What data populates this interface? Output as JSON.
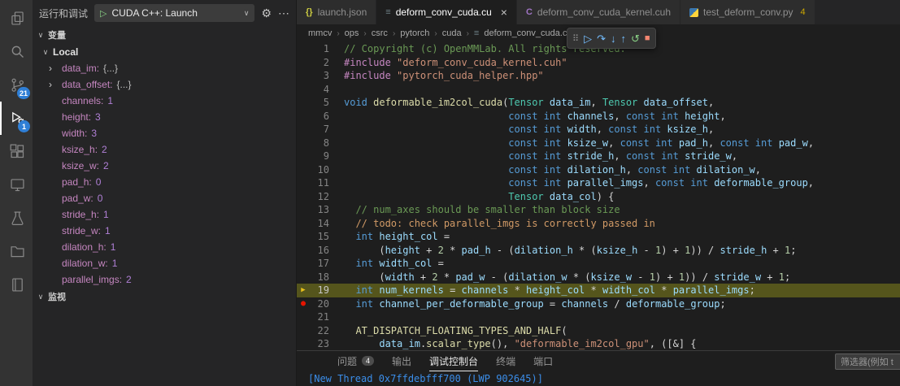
{
  "colors": {
    "badge_blue": "#2f7fd6",
    "current_line_bg": "#55551c",
    "breakpoint_red": "#e51400",
    "execution_arrow_yellow": "#e9c11c",
    "console_blue": "#3b8eea",
    "start_green": "#89d185",
    "debug_icon_blue": "#75beff",
    "stop_red": "#f48771"
  },
  "activity_bar": {
    "items": [
      {
        "name": "explorer"
      },
      {
        "name": "search"
      },
      {
        "name": "source-control",
        "badge": "21"
      },
      {
        "name": "run-debug",
        "badge": "1",
        "active": true
      },
      {
        "name": "extensions"
      },
      {
        "name": "remote"
      },
      {
        "name": "test"
      },
      {
        "name": "folder"
      },
      {
        "name": "notebook"
      }
    ]
  },
  "sidebar": {
    "title": "运行和调试",
    "icons": {
      "chevron_down": "∨",
      "chevron_right": "›"
    },
    "launch": {
      "config_name": "CUDA C++: Launch",
      "play_icon": "▷",
      "dropdown_icon": "∨",
      "gear_icon": "⚙",
      "more_icon": "⋯"
    },
    "variables_section": "变量",
    "scope_label": "Local",
    "watch_section": "监视",
    "variables": [
      {
        "name": "data_im",
        "value": "{...}",
        "expandable": true
      },
      {
        "name": "data_offset",
        "value": "{...}",
        "expandable": true
      },
      {
        "name": "channels",
        "value": "1"
      },
      {
        "name": "height",
        "value": "3"
      },
      {
        "name": "width",
        "value": "3"
      },
      {
        "name": "ksize_h",
        "value": "2"
      },
      {
        "name": "ksize_w",
        "value": "2"
      },
      {
        "name": "pad_h",
        "value": "0"
      },
      {
        "name": "pad_w",
        "value": "0"
      },
      {
        "name": "stride_h",
        "value": "1"
      },
      {
        "name": "stride_w",
        "value": "1"
      },
      {
        "name": "dilation_h",
        "value": "1"
      },
      {
        "name": "dilation_w",
        "value": "1"
      },
      {
        "name": "parallel_imgs",
        "value": "2"
      }
    ]
  },
  "editor_tabs": [
    {
      "label": "launch.json",
      "icon": "json-icon",
      "glyph": "{}",
      "glyph_color": "#cbcb41"
    },
    {
      "label": "deform_conv_cuda.cu",
      "icon": "cuda-source-icon",
      "glyph": "≡",
      "glyph_color": "#6d8086",
      "active": true,
      "close_icon": "×"
    },
    {
      "label": "deform_conv_cuda_kernel.cuh",
      "icon": "c-header-icon",
      "glyph": "C",
      "glyph_color": "#a074c4"
    },
    {
      "label": "test_deform_conv.py",
      "icon": "python-icon",
      "badge": "4"
    }
  ],
  "breadcrumb": {
    "path": [
      "mmcv",
      "ops",
      "csrc",
      "pytorch",
      "cuda"
    ],
    "file": "deform_conv_cuda.cu",
    "file_icon": "≡",
    "separator": "›"
  },
  "debug_toolbar": {
    "grip_icon": "⠿",
    "buttons": [
      {
        "name": "continue",
        "glyph": "▷",
        "color": "#75beff"
      },
      {
        "name": "step-over",
        "glyph": "↷",
        "color": "#75beff"
      },
      {
        "name": "step-into",
        "glyph": "↓",
        "color": "#75beff"
      },
      {
        "name": "step-out",
        "glyph": "↑",
        "color": "#75beff"
      },
      {
        "name": "restart",
        "glyph": "↺",
        "color": "#89d185"
      },
      {
        "name": "stop",
        "glyph": "■",
        "color": "#f48771"
      }
    ]
  },
  "editor": {
    "lines": [
      {
        "n": 1,
        "t": [
          [
            "cm",
            "// Copyright (c) OpenMMLab. All rights reserved."
          ]
        ]
      },
      {
        "n": 2,
        "t": [
          [
            "pp",
            "#include "
          ],
          [
            "st",
            "\"deform_conv_cuda_kernel.cuh\""
          ]
        ]
      },
      {
        "n": 3,
        "t": [
          [
            "pp",
            "#include "
          ],
          [
            "st",
            "\"pytorch_cuda_helper.hpp\""
          ]
        ]
      },
      {
        "n": 4,
        "t": []
      },
      {
        "n": 5,
        "t": [
          [
            "kw",
            "void "
          ],
          [
            "fn",
            "deformable_im2col_cuda"
          ],
          [
            "pl",
            "("
          ],
          [
            "ty",
            "Tensor"
          ],
          [
            "pl",
            " "
          ],
          [
            "vr",
            "data_im"
          ],
          [
            "pl",
            ", "
          ],
          [
            "ty",
            "Tensor"
          ],
          [
            "pl",
            " "
          ],
          [
            "vr",
            "data_offset"
          ],
          [
            "pl",
            ","
          ]
        ]
      },
      {
        "n": 6,
        "t": [
          [
            "pl",
            "                            "
          ],
          [
            "kw",
            "const int"
          ],
          [
            "pl",
            " "
          ],
          [
            "vr",
            "channels"
          ],
          [
            "pl",
            ", "
          ],
          [
            "kw",
            "const int"
          ],
          [
            "pl",
            " "
          ],
          [
            "vr",
            "height"
          ],
          [
            "pl",
            ","
          ]
        ]
      },
      {
        "n": 7,
        "t": [
          [
            "pl",
            "                            "
          ],
          [
            "kw",
            "const int"
          ],
          [
            "pl",
            " "
          ],
          [
            "vr",
            "width"
          ],
          [
            "pl",
            ", "
          ],
          [
            "kw",
            "const int"
          ],
          [
            "pl",
            " "
          ],
          [
            "vr",
            "ksize_h"
          ],
          [
            "pl",
            ","
          ]
        ]
      },
      {
        "n": 8,
        "t": [
          [
            "pl",
            "                            "
          ],
          [
            "kw",
            "const int"
          ],
          [
            "pl",
            " "
          ],
          [
            "vr",
            "ksize_w"
          ],
          [
            "pl",
            ", "
          ],
          [
            "kw",
            "const int"
          ],
          [
            "pl",
            " "
          ],
          [
            "vr",
            "pad_h"
          ],
          [
            "pl",
            ", "
          ],
          [
            "kw",
            "const int"
          ],
          [
            "pl",
            " "
          ],
          [
            "vr",
            "pad_w"
          ],
          [
            "pl",
            ","
          ]
        ]
      },
      {
        "n": 9,
        "t": [
          [
            "pl",
            "                            "
          ],
          [
            "kw",
            "const int"
          ],
          [
            "pl",
            " "
          ],
          [
            "vr",
            "stride_h"
          ],
          [
            "pl",
            ", "
          ],
          [
            "kw",
            "const int"
          ],
          [
            "pl",
            " "
          ],
          [
            "vr",
            "stride_w"
          ],
          [
            "pl",
            ","
          ]
        ]
      },
      {
        "n": 10,
        "t": [
          [
            "pl",
            "                            "
          ],
          [
            "kw",
            "const int"
          ],
          [
            "pl",
            " "
          ],
          [
            "vr",
            "dilation_h"
          ],
          [
            "pl",
            ", "
          ],
          [
            "kw",
            "const int"
          ],
          [
            "pl",
            " "
          ],
          [
            "vr",
            "dilation_w"
          ],
          [
            "pl",
            ","
          ]
        ]
      },
      {
        "n": 11,
        "t": [
          [
            "pl",
            "                            "
          ],
          [
            "kw",
            "const int"
          ],
          [
            "pl",
            " "
          ],
          [
            "vr",
            "parallel_imgs"
          ],
          [
            "pl",
            ", "
          ],
          [
            "kw",
            "const int"
          ],
          [
            "pl",
            " "
          ],
          [
            "vr",
            "deformable_group"
          ],
          [
            "pl",
            ","
          ]
        ]
      },
      {
        "n": 12,
        "t": [
          [
            "pl",
            "                            "
          ],
          [
            "ty",
            "Tensor"
          ],
          [
            "pl",
            " "
          ],
          [
            "vr",
            "data_col"
          ],
          [
            "pl",
            ") {"
          ]
        ]
      },
      {
        "n": 13,
        "t": [
          [
            "pl",
            "  "
          ],
          [
            "cm",
            "// num_axes should be smaller than block size"
          ]
        ]
      },
      {
        "n": 14,
        "t": [
          [
            "pl",
            "  "
          ],
          [
            "td",
            "// todo: check parallel_imgs is correctly passed in"
          ]
        ]
      },
      {
        "n": 15,
        "t": [
          [
            "pl",
            "  "
          ],
          [
            "kw",
            "int"
          ],
          [
            "pl",
            " "
          ],
          [
            "vr",
            "height_col"
          ],
          [
            "pl",
            " ="
          ]
        ]
      },
      {
        "n": 16,
        "t": [
          [
            "pl",
            "      ("
          ],
          [
            "vr",
            "height"
          ],
          [
            "pl",
            " + "
          ],
          [
            "nu",
            "2"
          ],
          [
            "pl",
            " * "
          ],
          [
            "vr",
            "pad_h"
          ],
          [
            "pl",
            " - ("
          ],
          [
            "vr",
            "dilation_h"
          ],
          [
            "pl",
            " * ("
          ],
          [
            "vr",
            "ksize_h"
          ],
          [
            "pl",
            " - "
          ],
          [
            "nu",
            "1"
          ],
          [
            "pl",
            ") + "
          ],
          [
            "nu",
            "1"
          ],
          [
            "pl",
            ")) / "
          ],
          [
            "vr",
            "stride_h"
          ],
          [
            "pl",
            " + "
          ],
          [
            "nu",
            "1"
          ],
          [
            "pl",
            ";"
          ]
        ]
      },
      {
        "n": 17,
        "t": [
          [
            "pl",
            "  "
          ],
          [
            "kw",
            "int"
          ],
          [
            "pl",
            " "
          ],
          [
            "vr",
            "width_col"
          ],
          [
            "pl",
            " ="
          ]
        ]
      },
      {
        "n": 18,
        "t": [
          [
            "pl",
            "      ("
          ],
          [
            "vr",
            "width"
          ],
          [
            "pl",
            " + "
          ],
          [
            "nu",
            "2"
          ],
          [
            "pl",
            " * "
          ],
          [
            "vr",
            "pad_w"
          ],
          [
            "pl",
            " - ("
          ],
          [
            "vr",
            "dilation_w"
          ],
          [
            "pl",
            " * ("
          ],
          [
            "vr",
            "ksize_w"
          ],
          [
            "pl",
            " - "
          ],
          [
            "nu",
            "1"
          ],
          [
            "pl",
            ") + "
          ],
          [
            "nu",
            "1"
          ],
          [
            "pl",
            ")) / "
          ],
          [
            "vr",
            "stride_w"
          ],
          [
            "pl",
            " + "
          ],
          [
            "nu",
            "1"
          ],
          [
            "pl",
            ";"
          ]
        ]
      },
      {
        "n": 19,
        "current": true,
        "t": [
          [
            "pl",
            "  "
          ],
          [
            "kw",
            "int"
          ],
          [
            "pl",
            " "
          ],
          [
            "vr",
            "num_kernels"
          ],
          [
            "pl",
            " = "
          ],
          [
            "vr",
            "channels"
          ],
          [
            "pl",
            " * "
          ],
          [
            "vr",
            "height_col"
          ],
          [
            "pl",
            " * "
          ],
          [
            "vr",
            "width_col"
          ],
          [
            "pl",
            " * "
          ],
          [
            "vr",
            "parallel_imgs"
          ],
          [
            "pl",
            ";"
          ]
        ]
      },
      {
        "n": 20,
        "breakpoint": true,
        "t": [
          [
            "pl",
            "  "
          ],
          [
            "kw",
            "int"
          ],
          [
            "pl",
            " "
          ],
          [
            "vr",
            "channel_per_deformable_group"
          ],
          [
            "pl",
            " = "
          ],
          [
            "vr",
            "channels"
          ],
          [
            "pl",
            " / "
          ],
          [
            "vr",
            "deformable_group"
          ],
          [
            "pl",
            ";"
          ]
        ]
      },
      {
        "n": 21,
        "t": []
      },
      {
        "n": 22,
        "t": [
          [
            "pl",
            "  "
          ],
          [
            "fn",
            "AT_DISPATCH_FLOATING_TYPES_AND_HALF"
          ],
          [
            "pl",
            "("
          ]
        ]
      },
      {
        "n": 23,
        "t": [
          [
            "pl",
            "      "
          ],
          [
            "vr",
            "data_im"
          ],
          [
            "pl",
            "."
          ],
          [
            "fn",
            "scalar_type"
          ],
          [
            "pl",
            "(), "
          ],
          [
            "st",
            "\"deformable_im2col_gpu\""
          ],
          [
            "pl",
            ", ([&] {"
          ]
        ]
      }
    ]
  },
  "panel": {
    "tabs": [
      {
        "label": "问题",
        "badge": "4"
      },
      {
        "label": "输出"
      },
      {
        "label": "调试控制台",
        "active": true
      },
      {
        "label": "终端"
      },
      {
        "label": "端口"
      }
    ],
    "filter_text": "筛选器(例如 t",
    "console_line": "[New Thread 0x7ffdebfff700 (LWP 902645)]"
  }
}
